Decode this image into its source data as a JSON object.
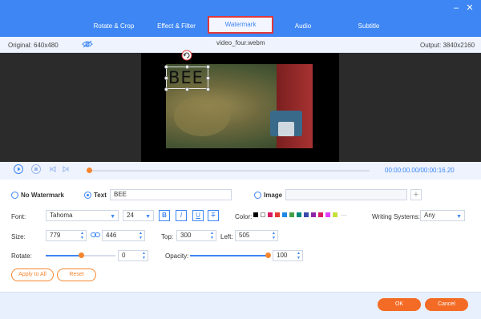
{
  "window": {
    "minimize": "–",
    "close": "✕"
  },
  "tabs": [
    "Rotate & Crop",
    "Effect & Filter",
    "Watermark",
    "Audio",
    "Subtitle"
  ],
  "infobar": {
    "original": "Original: 640x480",
    "filename": "video_four.webm",
    "output": "Output: 3840x2160"
  },
  "preview": {
    "watermark_text": "BEE"
  },
  "playback": {
    "time": "00:00:00.00/00:00:16.20",
    "progress": 0.0
  },
  "watermark": {
    "no_watermark_label": "No Watermark",
    "text_label": "Text",
    "text_value": "BEE",
    "image_label": "Image",
    "add": "+"
  },
  "font": {
    "label": "Font:",
    "family": "Tahoma",
    "size": "24",
    "bold": "B",
    "italic": "I",
    "underline": "U",
    "strike": "T",
    "color_label": "Color:",
    "colors": [
      "#000000",
      "#ffffff",
      "#d81b60",
      "#e53935",
      "#1e88e5",
      "#43a047",
      "#00897b",
      "#3949ab",
      "#8e24aa",
      "#d81b60",
      "#e040fb",
      "#c6e03a"
    ],
    "more": "···",
    "writing_label": "Writing Systems:",
    "writing_value": "Any"
  },
  "size": {
    "label": "Size:",
    "width": "779",
    "height": "446",
    "top_label": "Top:",
    "top": "300",
    "left_label": "Left:",
    "left": "505"
  },
  "rotate": {
    "label": "Rotate:",
    "value": "0",
    "level": 0.5
  },
  "opacity": {
    "label": "Opacity:",
    "value": "100",
    "level": 1.0
  },
  "actions": {
    "apply_all": "Apply to All",
    "reset": "Reset"
  },
  "footer": {
    "ok": "OK",
    "cancel": "Cancel"
  },
  "colors": {
    "accent": "#3d86f4",
    "orange": "#f36b25",
    "highlight": "#e0393b"
  }
}
